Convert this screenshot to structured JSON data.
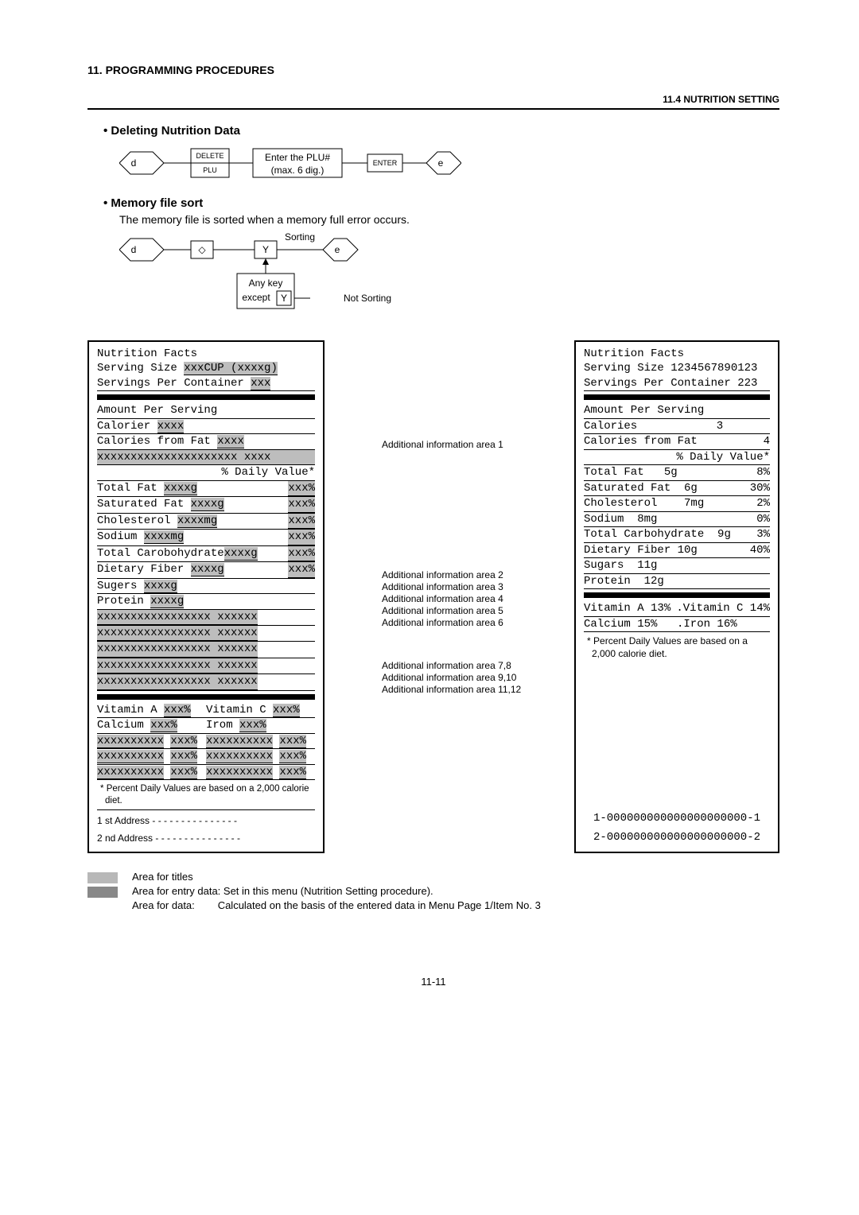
{
  "header": {
    "chapter": "11.  PROGRAMMING PROCEDURES",
    "section": "11.4 NUTRITION SETTING"
  },
  "topics": {
    "deleting": {
      "title": "Deleting Nutrition Data",
      "flow": {
        "d": "d",
        "delete": "DELETE",
        "plu": "PLU",
        "enter_plu_top": "Enter the PLU#",
        "enter_plu_bot": "(max. 6 dig.)",
        "enter": "ENTER",
        "e": "e"
      }
    },
    "memory": {
      "title": "Memory file sort",
      "desc": "The memory file is sorted when a memory full error occurs.",
      "flow": {
        "d": "d",
        "diamond": "◇",
        "y": "Y",
        "sorting": "Sorting",
        "e": "e",
        "anykey_top": "Any key",
        "anykey_bot": "except",
        "y2": "Y",
        "notsorting": "Not Sorting"
      }
    }
  },
  "template_label": {
    "title": "Nutrition Facts",
    "serving_size": "Serving Size",
    "serving_size_val": "xxxCUP (xxxxg)",
    "spc": "Servings Per Container",
    "spc_val": "xxx",
    "aps": "Amount Per Serving",
    "calories": "Calorier",
    "calories_val": "xxxx",
    "cff": "Calories from Fat",
    "cff_val": "xxxx",
    "extra_line": "xxxxxxxxxxxxxxxxxxxxx xxxx",
    "dv_header": "% Daily Value*",
    "rows": [
      {
        "name": "Total Fat",
        "val": "xxxxg",
        "dv": "xxx%"
      },
      {
        "name": " Saturated Fat",
        "val": "xxxxg",
        "dv": "xxx%"
      },
      {
        "name": "Cholesterol",
        "val": " xxxxmg",
        "dv": "xxx%"
      },
      {
        "name": "Sodium",
        "val": "xxxxmg",
        "dv": "xxx%"
      },
      {
        "name": "Total Carobohydrate",
        "val": "xxxxg",
        "dv": "xxx%"
      },
      {
        "name": " Dietary Fiber",
        "val": "xxxxg",
        "dv": "xxx%"
      }
    ],
    "sugars": "Sugers",
    "sugars_val": "xxxxg",
    "protein": "Protein",
    "protein_val": "xxxxg",
    "extras": [
      "xxxxxxxxxxxxxxxxx    xxxxxx",
      "xxxxxxxxxxxxxxxxx    xxxxxx",
      "xxxxxxxxxxxxxxxxx    xxxxxx",
      "xxxxxxxxxxxxxxxxx    xxxxxx",
      "xxxxxxxxxxxxxxxxx    xxxxxx"
    ],
    "vit_a": "Vitamin A",
    "vit_a_val": "xxx%",
    "vit_c": "Vitamin C",
    "vit_c_val": "xxx%",
    "calcium": "Calcium",
    "calcium_val": "xxx%",
    "iron": "Irom",
    "iron_val": "xxx%",
    "add_pairs": [
      {
        "l": "xxxxxxxxxx",
        "lv": "xxx%",
        "r": "xxxxxxxxxx",
        "rv": "xxx%"
      },
      {
        "l": "xxxxxxxxxx",
        "lv": "xxx%",
        "r": "xxxxxxxxxx",
        "rv": "xxx%"
      },
      {
        "l": "xxxxxxxxxx",
        "lv": "xxx%",
        "r": "xxxxxxxxxx",
        "rv": "xxx%"
      }
    ],
    "footnote_star": "*",
    "footnote": "Percent Daily Values are based on a 2,000 calorie diet.",
    "addr1": "1 st   Address - - - - - - - - - - - - - - -",
    "addr2": "2 nd  Address - - - - - - - - - - - - - - -"
  },
  "annotations": {
    "a1": "Additional information area 1",
    "a2": "Additional information area 2",
    "a3": "Additional information area 3",
    "a4": "Additional information area 4",
    "a5": "Additional information area 5",
    "a6": "Additional information area 6",
    "a78": "Additional information area 7,8",
    "a910": "Additional information area 9,10",
    "a1112": "Additional information area 11,12"
  },
  "example_label": {
    "title": "Nutrition Facts",
    "serving_size": "Serving Size 1234567890123",
    "spc": "Servings Per Container 223",
    "aps": "Amount Per Serving",
    "calories_lbl": "Calories",
    "calories_val": "3",
    "cff_lbl": "Calories from Fat",
    "cff_val": "4",
    "dv_header": "% Daily Value*",
    "rows": [
      {
        "name": "Total Fat",
        "val": "5g",
        "dv": "8%"
      },
      {
        "name": " Saturated Fat",
        "val": "6g",
        "dv": "30%"
      },
      {
        "name": "Cholesterol",
        "val": "7mg",
        "dv": "2%"
      },
      {
        "name": "Sodium",
        "val": "8mg",
        "dv": "0%"
      },
      {
        "name": "Total Carbohydrate",
        "val": "9g",
        "dv": "3%"
      },
      {
        "name": " Dietary Fiber",
        "val": "10g",
        "dv": "40%"
      }
    ],
    "sugars": " Sugars",
    "sugars_val": "11g",
    "protein": "Protein",
    "protein_val": "12g",
    "vit_a": "Vitamin A 13%",
    "vit_c": "Vitamin C 14%",
    "calcium": "Calcium   15%",
    "iron": "Iron      16%",
    "footnote_star": "*",
    "footnote": "Percent Daily Values are based on a 2,000 calorie diet.",
    "addr1": "1-000000000000000000000-1",
    "addr2": "2-000000000000000000000-2"
  },
  "legend": {
    "titles_lbl": "Area for titles",
    "entry_lbl": "Area for entry data:",
    "entry_desc": "Set in this menu (Nutrition Setting procedure).",
    "data_lbl": "Area for data:",
    "data_desc": "Calculated on the basis of the entered data in Menu Page 1/Item No. 3"
  },
  "page_number": "11-11",
  "chart_data": {
    "type": "table",
    "title": "Nutrition Facts example label values",
    "categories": [
      "Total Fat",
      "Saturated Fat",
      "Cholesterol",
      "Sodium",
      "Total Carbohydrate",
      "Dietary Fiber"
    ],
    "series": [
      {
        "name": "Amount",
        "values": [
          "5g",
          "6g",
          "7mg",
          "8mg",
          "9g",
          "10g"
        ]
      },
      {
        "name": "% Daily Value",
        "values": [
          8,
          30,
          2,
          0,
          3,
          40
        ]
      }
    ],
    "extra": {
      "Calories": 3,
      "Calories from Fat": 4,
      "Sugars": "11g",
      "Protein": "12g",
      "Vitamin A %": 13,
      "Vitamin C %": 14,
      "Calcium %": 15,
      "Iron %": 16,
      "Servings Per Container": 223
    }
  }
}
